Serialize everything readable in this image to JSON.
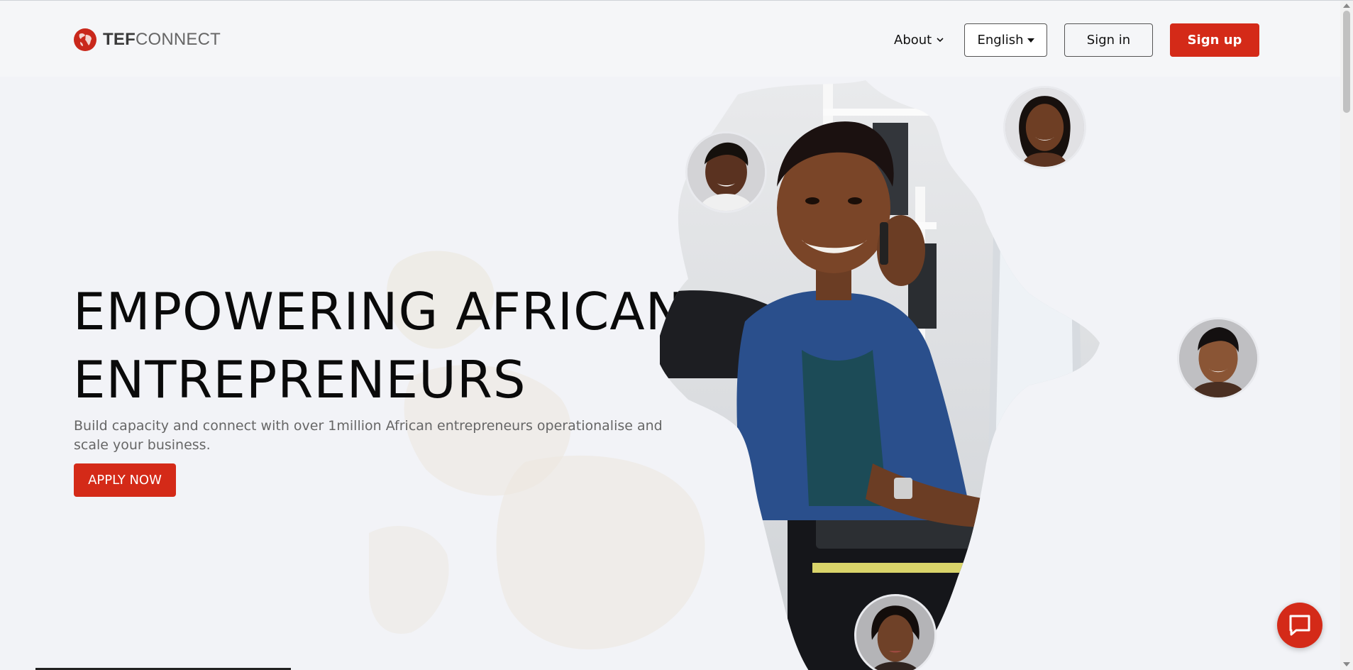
{
  "brand": {
    "name_bold": "TEF",
    "name_light": "CONNECT",
    "color": "#d42a18"
  },
  "nav": {
    "about_label": "About",
    "language_label": "English",
    "signin_label": "Sign in",
    "signup_label": "Sign up"
  },
  "hero": {
    "title_line1": "EMPOWERING AFRICAN",
    "title_line2": "ENTREPRENEURS",
    "subtitle": "Build capacity and connect with over 1million African entrepreneurs operationalise and scale your business.",
    "cta_label": "APPLY NOW"
  },
  "icons": {
    "logo": "globe-icon",
    "about_chevron": "chevron-down-icon",
    "language_caret": "caret-down-icon",
    "chat": "chat-bubble-icon"
  },
  "colors": {
    "accent": "#d42a18",
    "background": "#f2f3f7",
    "navbar": "#f5f6f8"
  }
}
